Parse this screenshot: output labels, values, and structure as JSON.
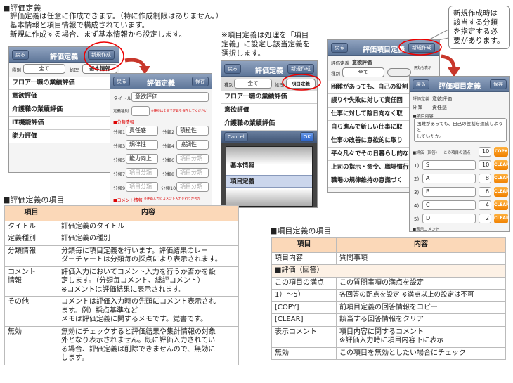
{
  "heading_eval": "■評価定義",
  "intro_lines": [
    "評価定義は任意に作成できます。（特に作成制限はありません。）",
    "基本情報と項目情報で構成されています。",
    "新規に作成する場合、まず基本情報から設定します。"
  ],
  "note_item_lines": [
    "※項目定義は処理を「項目",
    "定義」に設定し該当定義を",
    "選択します。"
  ],
  "callout_lines": [
    "新規作成時は",
    "該当する分類",
    "を指定する必",
    "要があります。"
  ],
  "phone1": {
    "back": "戻る",
    "title": "評価定義",
    "new_btn": "新規作成",
    "type_label": "種別",
    "type_value": "全て",
    "proc_label": "処理",
    "proc_value": "基本情報",
    "rows": [
      "フロアー職の業績評価",
      "意欲評価",
      "介護職の業績評価",
      "IT機能評価",
      "能力評価"
    ]
  },
  "phone2": {
    "back": "戻る",
    "title": "評価定義",
    "save": "保存",
    "title_label": "タイトル",
    "title_value": "意欲評価",
    "kind_label": "定義種別",
    "kind_note": "※種別は全般で定義を保存してください",
    "cat_header": "■分類情報",
    "cats": [
      {
        "label": "分類1",
        "value": "責任感",
        "ph": false
      },
      {
        "label": "分類2",
        "value": "積極性",
        "ph": false
      },
      {
        "label": "分類3",
        "value": "規律性",
        "ph": false
      },
      {
        "label": "分類4",
        "value": "協調性",
        "ph": false
      },
      {
        "label": "分類5",
        "value": "能力向上...",
        "ph": false
      },
      {
        "label": "分類6",
        "value": "項目分類",
        "ph": true
      },
      {
        "label": "分類7",
        "value": "項目分類",
        "ph": true
      },
      {
        "label": "分類8",
        "value": "項目分類",
        "ph": true
      },
      {
        "label": "分類9",
        "value": "項目分類",
        "ph": true
      },
      {
        "label": "分類10",
        "value": "項目分類",
        "ph": true
      }
    ],
    "comment_header": "■コメント情報",
    "comment_note": "※評価入力でコメント入力を行うか否か"
  },
  "phone3": {
    "back": "戻る",
    "title": "評価定義",
    "new_btn": "新規作成",
    "type_label": "種別",
    "type_value": "全て",
    "proc_label": "処理",
    "proc_value": "項目定義",
    "rows": [
      "フロアー職の業績評価",
      "意欲評価",
      "介護職の業績評価"
    ],
    "cancel": "Cancel",
    "ok": "OK",
    "picker": [
      "基本情報",
      "項目定義"
    ]
  },
  "phone4": {
    "back": "戻る",
    "title": "評価項目定義",
    "new_btn": "新規作成",
    "def_label": "評価定義",
    "def_value": "意欲評価",
    "type_label": "種別",
    "type_value": "全て",
    "toggle_label": "無効も表示",
    "rows": [
      "困難があっても、自己の役割",
      "誤りや失敗に対して責任回",
      "仕事に対して陰日向なく取",
      "自ら進んで新しい仕事に取",
      "仕事の改善に意欲的に取り",
      "平々凡々でその日暮らし的な",
      "上司の指示・命令、職場慣行",
      "職場の規律維持の意識づく"
    ]
  },
  "phone5": {
    "back": "戻る",
    "title": "評価項目定義",
    "save": "保存",
    "def_label": "評価定義",
    "def_value": "意欲評価",
    "cat_label": "分 類",
    "cat_value": "責任感",
    "item_header": "■項目内容",
    "item_text": [
      "困難があっても、自己の役割を達成しようと",
      "していたか。"
    ],
    "eval_label": "■評価（回答）",
    "max_label": "この項目の満点",
    "max_value": "10",
    "copy": "COPY",
    "answers": [
      {
        "n": "1)",
        "text": "S",
        "score": "10"
      },
      {
        "n": "2)",
        "text": "A",
        "score": "8"
      },
      {
        "n": "3)",
        "text": "B",
        "score": "6"
      },
      {
        "n": "4)",
        "text": "C",
        "score": "4"
      },
      {
        "n": "5)",
        "text": "D",
        "score": "2"
      }
    ],
    "clear": "CLEAR",
    "comment_header": "■表示コメント"
  },
  "table1": {
    "heading": "■評価定義の項目",
    "col_item": "項目",
    "col_content": "内容",
    "rows": [
      {
        "item": "タイトル",
        "content": "評価定義のタイトル"
      },
      {
        "item": "定義種別",
        "content": "評価定義の種別"
      },
      {
        "item": "分類情報",
        "content": "分類毎に項目定義を行います。評価結果のレー\nダーチャートは分類毎の採点により表示されます。"
      },
      {
        "item": "コメント\n情報",
        "content": "評価入力においてコメント入力を行うか否かを設\n定します。（分類毎コメント、総評コメント）\n※コメントは評価結果に表示されます。"
      },
      {
        "item": "その他",
        "content": "コメントは評価入力時の先頭にコメント表示され\nます。例）採点基準など\nメモは評価定義に関するメモです。覚書です。"
      },
      {
        "item": "無効",
        "content": "無効にチェックすると評価結果や集計情報の対象\n外となり表示されません。既に評価入力されてい\nる場合、評価定義は削除できませんので、無効に\nします。"
      }
    ]
  },
  "table2": {
    "heading": "■項目定義の項目",
    "col_item": "項目",
    "col_content": "内容",
    "rows": [
      {
        "item": "項目内容",
        "content": "質問事項",
        "sub": false
      },
      {
        "item": "■評価（回答）",
        "content": "",
        "sub": true
      },
      {
        "item": "この項目の満点",
        "content": "この質問事項の満点を設定",
        "sub": false
      },
      {
        "item": "1）～5）",
        "content": "各回答の配点を設定 ※満点以上の設定は不可",
        "sub": false
      },
      {
        "item": "[COPY]",
        "content": "前項目定義の回答情報をコピー",
        "sub": false
      },
      {
        "item": "[CLEAR]",
        "content": "該当する回答情報をクリア",
        "sub": false
      },
      {
        "item": "表示コメント",
        "content": "項目内容に関するコメント\n※評価入力時に項目内容下に表示",
        "sub": false
      },
      {
        "item": "無効",
        "content": "この項目を無効としたい場合にチェック",
        "sub": false
      }
    ]
  }
}
